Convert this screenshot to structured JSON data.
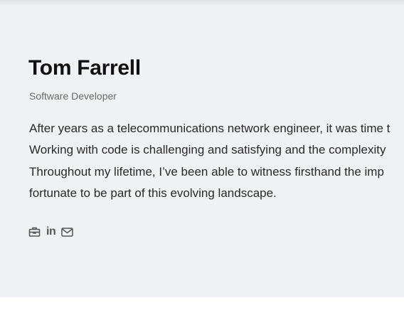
{
  "profile": {
    "name": "Tom Farrell",
    "title": "Software Developer",
    "bio_lines": [
      "After years as a telecommunications network engineer, it was time t",
      "Working with code is challenging and satisfying and the complexity",
      "Throughout my lifetime, I’ve been able to witness firsthand the imp",
      "fortunate to be part of this evolving landscape."
    ]
  },
  "social": {
    "icons": [
      "briefcase-icon",
      "linkedin-icon",
      "email-icon"
    ],
    "linkedin_glyph": "in"
  },
  "colors": {
    "card_background": "#f0f1f5",
    "page_background": "#ffffff",
    "heading": "#111111",
    "subtitle": "#6b6b6b",
    "body_text": "#2a2a2a",
    "icon": "#555555"
  }
}
